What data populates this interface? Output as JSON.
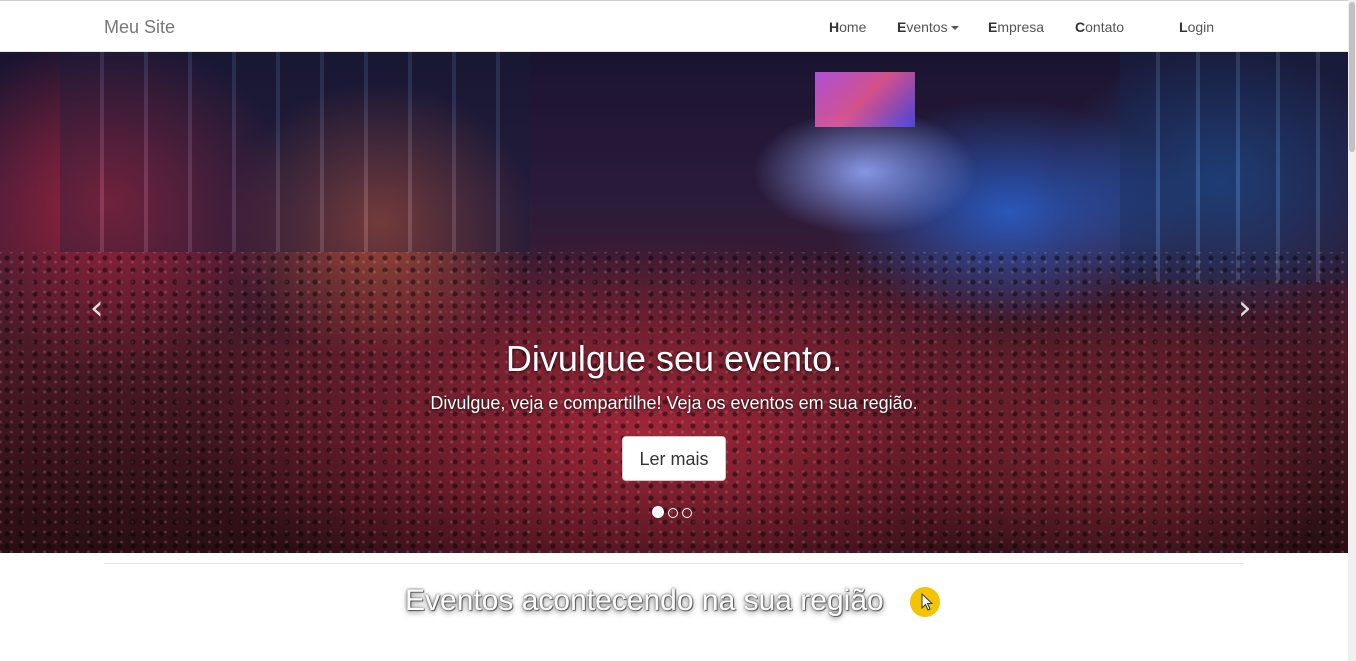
{
  "navbar": {
    "brand": "Meu Site",
    "items": [
      {
        "first": "H",
        "rest": "ome"
      },
      {
        "first": "E",
        "rest": "ventos",
        "dropdown": true
      },
      {
        "first": "E",
        "rest": "mpresa"
      },
      {
        "first": "C",
        "rest": "ontato"
      },
      {
        "first": "L",
        "rest": "ogin"
      }
    ]
  },
  "carousel": {
    "title": "Divulgue seu evento.",
    "text": "Divulgue, veja e compartilhe! Veja os eventos em sua região.",
    "button_label": "Ler mais",
    "prev_icon": "‹",
    "next_icon": "›",
    "slide_count": 3,
    "active_slide": 1
  },
  "section": {
    "title": "Eventos acontecendo na sua região"
  },
  "colors": {
    "cursor_highlight": "#f5c400"
  }
}
